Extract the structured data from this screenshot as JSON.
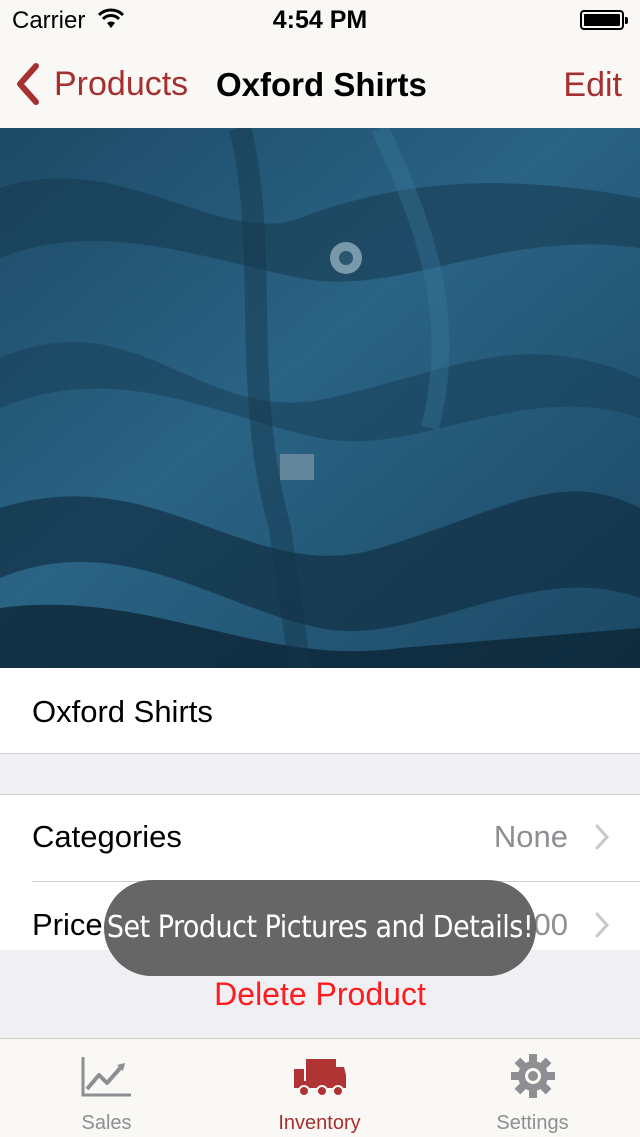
{
  "status_bar": {
    "carrier": "Carrier",
    "time": "4:54 PM"
  },
  "nav": {
    "back_label": "Products",
    "title": "Oxford Shirts",
    "edit_label": "Edit"
  },
  "product": {
    "name": "Oxford Shirts"
  },
  "cells": [
    {
      "label": "Categories",
      "value": "None"
    },
    {
      "label": "Price",
      "value": "00"
    }
  ],
  "delete_label": "Delete Product",
  "toast": {
    "message": "Set Product Pictures and Details!"
  },
  "tabs": [
    {
      "label": "Sales",
      "icon": "chart-icon",
      "selected": false
    },
    {
      "label": "Inventory",
      "icon": "truck-icon",
      "selected": true
    },
    {
      "label": "Settings",
      "icon": "gear-icon",
      "selected": false
    }
  ],
  "colors": {
    "accent": "#a53030",
    "destructive": "#ff1c1c",
    "inactive_tab": "#8e8e93"
  }
}
